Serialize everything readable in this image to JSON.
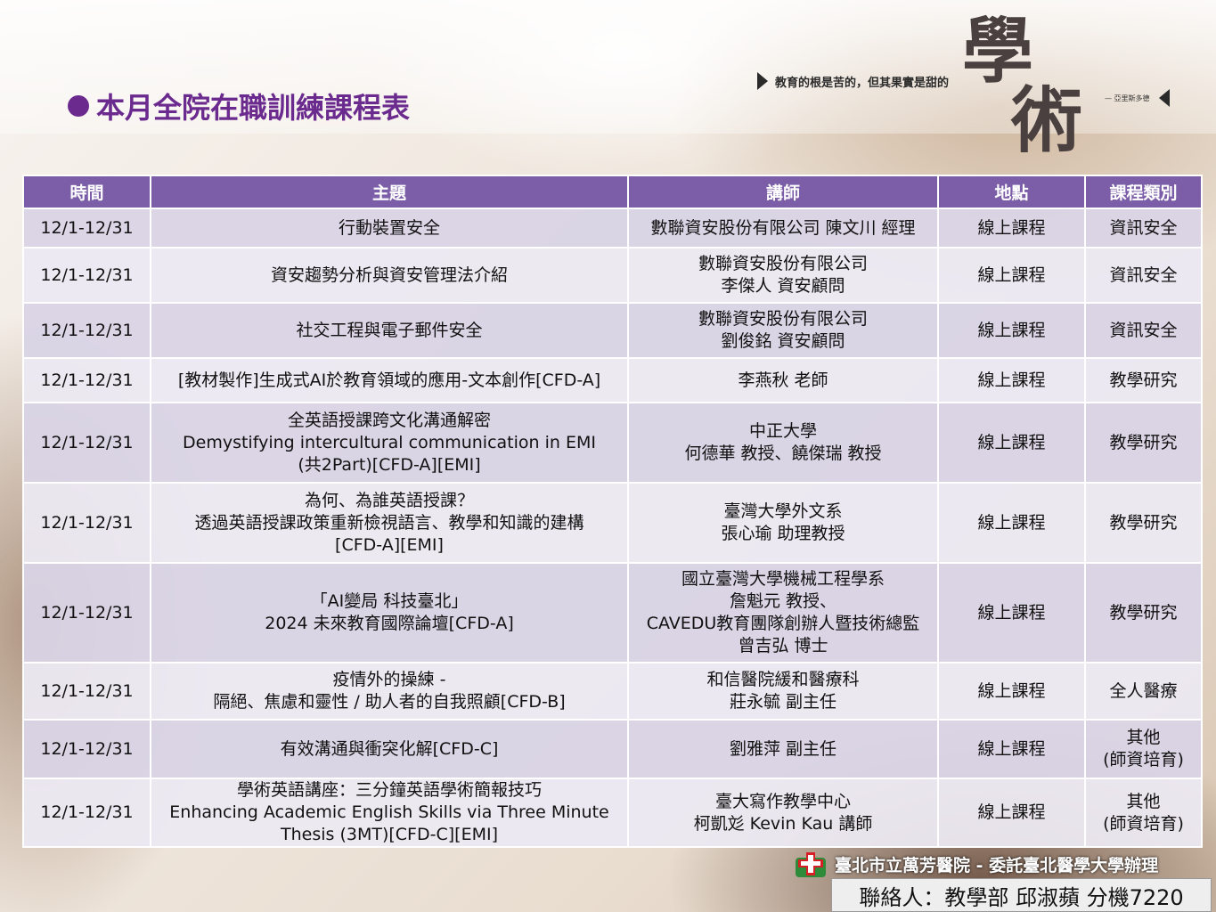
{
  "header": {
    "title": "本月全院在職訓練課程表",
    "slogan": "教育的根是苦的，但其果實是甜的",
    "slogan_attribution": "— 亞里斯多德",
    "logo_text_1": "學",
    "logo_text_2": "術"
  },
  "table": {
    "columns": [
      "時間",
      "主題",
      "講師",
      "地點",
      "課程類別"
    ],
    "rows": [
      {
        "time": "12/1-12/31",
        "topic": [
          "行動裝置安全"
        ],
        "lecturer": [
          "數聯資安股份有限公司 陳文川 經理"
        ],
        "location": "線上課程",
        "category": [
          "資訊安全"
        ]
      },
      {
        "time": "12/1-12/31",
        "topic": [
          "資安趨勢分析與資安管理法介紹"
        ],
        "lecturer": [
          "數聯資安股份有限公司",
          "李傑人 資安顧問"
        ],
        "location": "線上課程",
        "category": [
          "資訊安全"
        ]
      },
      {
        "time": "12/1-12/31",
        "topic": [
          "社交工程與電子郵件安全"
        ],
        "lecturer": [
          "數聯資安股份有限公司",
          "劉俊銘 資安顧問"
        ],
        "location": "線上課程",
        "category": [
          "資訊安全"
        ]
      },
      {
        "time": "12/1-12/31",
        "topic": [
          "[教材製作]生成式AI於教育領域的應用-文本創作[CFD-A]"
        ],
        "lecturer": [
          "李燕秋 老師"
        ],
        "location": "線上課程",
        "category": [
          "教學研究"
        ]
      },
      {
        "time": "12/1-12/31",
        "topic": [
          "全英語授課跨文化溝通解密",
          "Demystifying intercultural communication in EMI",
          "(共2Part)[CFD-A][EMI]"
        ],
        "lecturer": [
          "中正大學",
          "何德華 教授、饒傑瑞 教授"
        ],
        "location": "線上課程",
        "category": [
          "教學研究"
        ]
      },
      {
        "time": "12/1-12/31",
        "topic": [
          "為何、為誰英語授課？",
          "透過英語授課政策重新檢視語言、教學和知識的建構",
          "[CFD-A][EMI]"
        ],
        "lecturer": [
          "臺灣大學外文系",
          "張心瑜 助理教授"
        ],
        "location": "線上課程",
        "category": [
          "教學研究"
        ]
      },
      {
        "time": "12/1-12/31",
        "topic": [
          "「AI變局 科技臺北」",
          "2024 未來教育國際論壇[CFD-A]"
        ],
        "lecturer": [
          "國立臺灣大學機械工程學系",
          "詹魁元 教授、",
          "CAVEDU教育團隊創辦人暨技術總監",
          "曾吉弘 博士"
        ],
        "location": "線上課程",
        "category": [
          "教學研究"
        ]
      },
      {
        "time": "12/1-12/31",
        "topic": [
          "疫情外的操練 -",
          "隔絕、焦慮和靈性 / 助人者的自我照顧[CFD-B]"
        ],
        "lecturer": [
          "和信醫院緩和醫療科",
          "莊永毓 副主任"
        ],
        "location": "線上課程",
        "category": [
          "全人醫療"
        ]
      },
      {
        "time": "12/1-12/31",
        "topic": [
          "有效溝通與衝突化解[CFD-C]"
        ],
        "lecturer": [
          "劉雅萍 副主任"
        ],
        "location": "線上課程",
        "category": [
          "其他",
          "(師資培育)"
        ]
      },
      {
        "time": "12/1-12/31",
        "topic": [
          "學術英語講座：三分鐘英語學術簡報技巧",
          "Enhancing Academic English Skills via Three Minute",
          "Thesis (3MT)[CFD-C][EMI]"
        ],
        "lecturer": [
          "臺大寫作教學中心",
          "柯凱彣 Kevin Kau 講師"
        ],
        "location": "線上課程",
        "category": [
          "其他",
          "(師資培育)"
        ]
      }
    ]
  },
  "footer": {
    "hospital": "臺北市立萬芳醫院 - 委託臺北醫學大學辦理",
    "contact": "聯絡人：教學部 邱淑蘋 分機7220"
  }
}
